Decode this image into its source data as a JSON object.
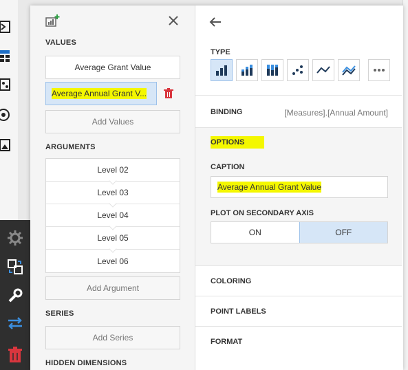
{
  "left_panel": {
    "values_label": "VALUES",
    "values": [
      "Average Grant Value",
      "Average Annual Grant V..."
    ],
    "add_values": "Add Values",
    "arguments_label": "ARGUMENTS",
    "arguments": [
      "Level 02",
      "Level 03",
      "Level 04",
      "Level 05",
      "Level 06"
    ],
    "add_argument": "Add Argument",
    "series_label": "SERIES",
    "add_series": "Add Series",
    "hidden_dimensions_label": "HIDDEN DIMENSIONS"
  },
  "right_panel": {
    "type_label": "TYPE",
    "type_icons": [
      "bar-chart-icon",
      "stacked-bar-icon",
      "full-stacked-bar-icon",
      "scatter-icon",
      "line-icon",
      "area-line-icon",
      "more-icon"
    ],
    "binding_label": "BINDING",
    "binding_value": "[Measures].[Annual Amount]",
    "options_label": "OPTIONS",
    "caption_label": "CAPTION",
    "caption_value": "Average Annual Grant Value",
    "secondary_axis_label": "PLOT ON SECONDARY AXIS",
    "toggle_on": "ON",
    "toggle_off": "OFF",
    "coloring": "COLORING",
    "point_labels": "POINT LABELS",
    "format": "FORMAT"
  },
  "colors": {
    "highlight": "#f4f700",
    "selected": "#d6e6f7",
    "accent_blue": "#1e6fc7",
    "delete_red": "#d9363e"
  }
}
